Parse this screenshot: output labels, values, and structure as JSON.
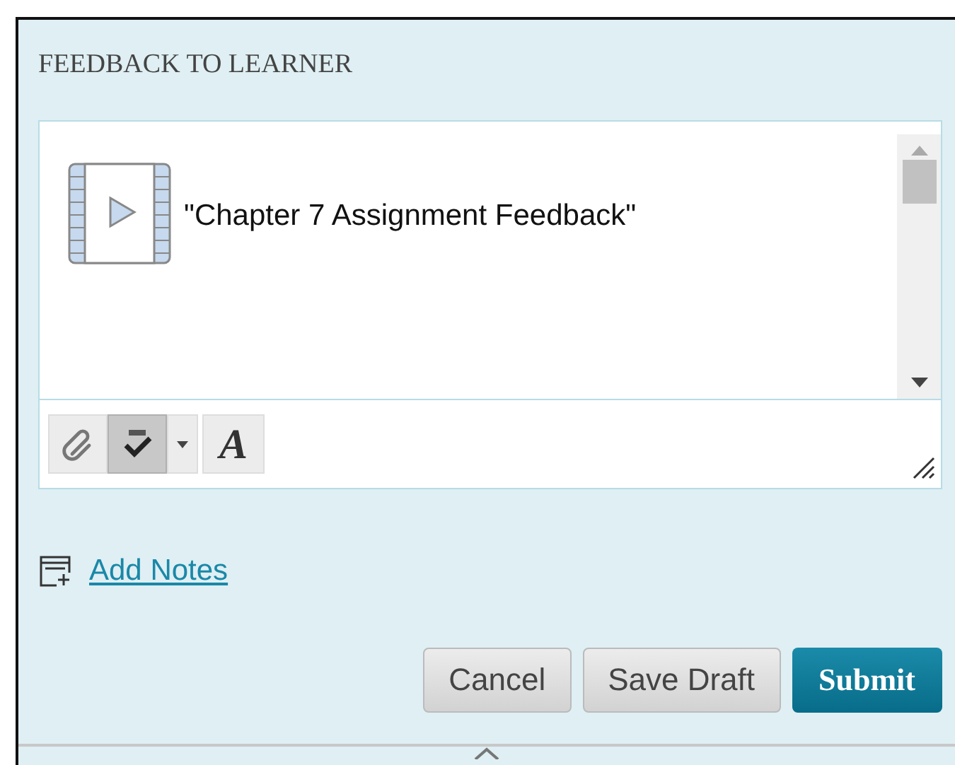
{
  "section": {
    "title": "FEEDBACK TO LEARNER"
  },
  "editor": {
    "content": "\"Chapter 7 Assignment Feedback\"",
    "toolbar": [
      {
        "kind": "attach",
        "selected": false
      },
      {
        "kind": "spellcheck",
        "selected": true
      },
      {
        "kind": "font",
        "label": "A",
        "selected": false
      }
    ]
  },
  "add_notes": {
    "label": "Add Notes"
  },
  "buttons": [
    {
      "label": "Cancel",
      "kind": "secondary"
    },
    {
      "label": "Save Draft",
      "kind": "secondary"
    },
    {
      "label": "Submit",
      "kind": "primary"
    }
  ]
}
